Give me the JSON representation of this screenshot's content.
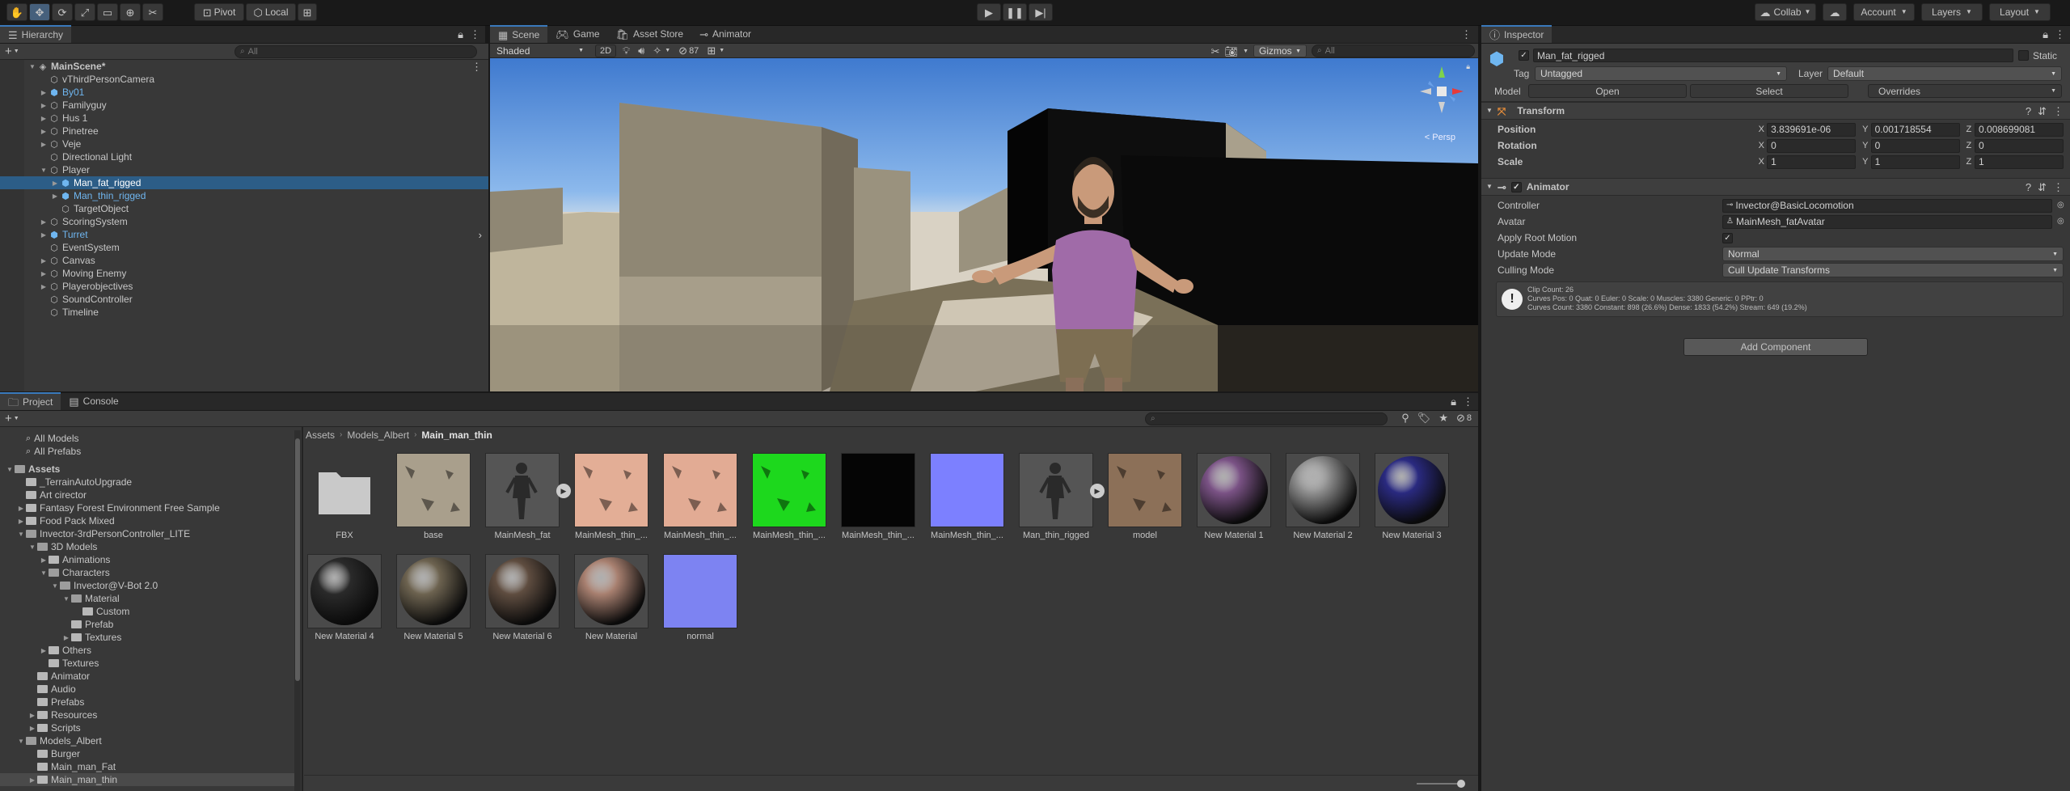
{
  "toolbar": {
    "pivot": "Pivot",
    "local": "Local",
    "collab": "Collab",
    "account": "Account",
    "layers": "Layers",
    "layout": "Layout"
  },
  "hierarchy": {
    "tab": "Hierarchy",
    "search_placeholder": "All",
    "items": [
      {
        "label": "MainScene*",
        "depth": 0,
        "expand": "open",
        "icon": "scene-icon",
        "bold": true
      },
      {
        "label": "vThirdPersonCamera",
        "depth": 1,
        "expand": "",
        "icon": "gameobject-icon"
      },
      {
        "label": "By01",
        "depth": 1,
        "expand": "closed",
        "icon": "prefab-icon",
        "prefab": true
      },
      {
        "label": "Familyguy",
        "depth": 1,
        "expand": "closed",
        "icon": "gameobject-icon"
      },
      {
        "label": "Hus 1",
        "depth": 1,
        "expand": "closed",
        "icon": "gameobject-icon"
      },
      {
        "label": "Pinetree",
        "depth": 1,
        "expand": "closed",
        "icon": "gameobject-icon"
      },
      {
        "label": "Veje",
        "depth": 1,
        "expand": "closed",
        "icon": "gameobject-icon"
      },
      {
        "label": "Directional Light",
        "depth": 1,
        "expand": "",
        "icon": "gameobject-icon"
      },
      {
        "label": "Player",
        "depth": 1,
        "expand": "open",
        "icon": "gameobject-icon"
      },
      {
        "label": "Man_fat_rigged",
        "depth": 2,
        "expand": "closed",
        "icon": "prefab-icon",
        "selected": true
      },
      {
        "label": "Man_thin_rigged",
        "depth": 2,
        "expand": "closed",
        "icon": "prefab-icon",
        "prefab": true
      },
      {
        "label": "TargetObject",
        "depth": 2,
        "expand": "",
        "icon": "gameobject-icon"
      },
      {
        "label": "ScoringSystem",
        "depth": 1,
        "expand": "closed",
        "icon": "gameobject-icon"
      },
      {
        "label": "Turret",
        "depth": 1,
        "expand": "closed",
        "icon": "prefab-icon",
        "prefab": true
      },
      {
        "label": "EventSystem",
        "depth": 1,
        "expand": "",
        "icon": "gameobject-icon"
      },
      {
        "label": "Canvas",
        "depth": 1,
        "expand": "closed",
        "icon": "gameobject-icon"
      },
      {
        "label": "Moving Enemy",
        "depth": 1,
        "expand": "closed",
        "icon": "gameobject-icon"
      },
      {
        "label": "Playerobjectives",
        "depth": 1,
        "expand": "closed",
        "icon": "gameobject-icon"
      },
      {
        "label": "SoundController",
        "depth": 1,
        "expand": "",
        "icon": "gameobject-icon"
      },
      {
        "label": "Timeline",
        "depth": 1,
        "expand": "",
        "icon": "gameobject-icon"
      }
    ]
  },
  "scene": {
    "tabs": [
      "Scene",
      "Game",
      "Asset Store",
      "Animator"
    ],
    "shading": "Shaded",
    "mode_2d": "2D",
    "hidden_count": "87",
    "gizmos": "Gizmos",
    "search_placeholder": "All",
    "persp": "< Persp"
  },
  "project": {
    "tabs": [
      "Project",
      "Console"
    ],
    "hidden_count": "8",
    "breadcrumb": [
      "Assets",
      "Models_Albert",
      "Main_man_thin"
    ],
    "favorites": [
      "All Models",
      "All Prefabs"
    ],
    "tree": [
      {
        "label": "Assets",
        "depth": 0,
        "expand": "open",
        "bold": true
      },
      {
        "label": "_TerrainAutoUpgrade",
        "depth": 1,
        "expand": ""
      },
      {
        "label": "Art cirector",
        "depth": 1,
        "expand": ""
      },
      {
        "label": "Fantasy Forest Environment Free Sample",
        "depth": 1,
        "expand": "closed"
      },
      {
        "label": "Food Pack Mixed",
        "depth": 1,
        "expand": "closed"
      },
      {
        "label": "Invector-3rdPersonController_LITE",
        "depth": 1,
        "expand": "open"
      },
      {
        "label": "3D Models",
        "depth": 2,
        "expand": "open"
      },
      {
        "label": "Animations",
        "depth": 3,
        "expand": "closed"
      },
      {
        "label": "Characters",
        "depth": 3,
        "expand": "open"
      },
      {
        "label": "Invector@V-Bot 2.0",
        "depth": 4,
        "expand": "open"
      },
      {
        "label": "Material",
        "depth": 5,
        "expand": "open"
      },
      {
        "label": "Custom",
        "depth": 6,
        "expand": ""
      },
      {
        "label": "Prefab",
        "depth": 5,
        "expand": ""
      },
      {
        "label": "Textures",
        "depth": 5,
        "expand": "closed"
      },
      {
        "label": "Others",
        "depth": 3,
        "expand": "closed"
      },
      {
        "label": "Textures",
        "depth": 3,
        "expand": ""
      },
      {
        "label": "Animator",
        "depth": 2,
        "expand": ""
      },
      {
        "label": "Audio",
        "depth": 2,
        "expand": ""
      },
      {
        "label": "Prefabs",
        "depth": 2,
        "expand": ""
      },
      {
        "label": "Resources",
        "depth": 2,
        "expand": "closed"
      },
      {
        "label": "Scripts",
        "depth": 2,
        "expand": "closed"
      },
      {
        "label": "Models_Albert",
        "depth": 1,
        "expand": "open"
      },
      {
        "label": "Burger",
        "depth": 2,
        "expand": ""
      },
      {
        "label": "Main_man_Fat",
        "depth": 2,
        "expand": ""
      },
      {
        "label": "Main_man_thin",
        "depth": 2,
        "expand": "closed",
        "selected": true
      }
    ],
    "assets": [
      {
        "label": "FBX",
        "kind": "folder"
      },
      {
        "label": "base",
        "kind": "texture",
        "color": "#a99f8c"
      },
      {
        "label": "MainMesh_fat",
        "kind": "model",
        "play": true
      },
      {
        "label": "MainMesh_thin_...",
        "kind": "texture",
        "color": "#e3ae96"
      },
      {
        "label": "MainMesh_thin_...",
        "kind": "texture",
        "color": "#e2ab94"
      },
      {
        "label": "MainMesh_thin_...",
        "kind": "texture",
        "color": "#1dd81d"
      },
      {
        "label": "MainMesh_thin_...",
        "kind": "solid",
        "color": "#050505"
      },
      {
        "label": "MainMesh_thin_...",
        "kind": "solid",
        "color": "#7c80ff"
      },
      {
        "label": "Man_thin_rigged",
        "kind": "model",
        "play": true
      },
      {
        "label": "model",
        "kind": "texture",
        "color": "#8c7058"
      },
      {
        "label": "New Material 1",
        "kind": "sphere",
        "color": "#7a5285"
      },
      {
        "label": "New Material 2",
        "kind": "sphere",
        "color": "#8e8e8e"
      },
      {
        "label": "New Material 3",
        "kind": "sphere",
        "color": "#2a2a80"
      },
      {
        "label": "New Material 4",
        "kind": "sphere",
        "color": "#2a2a2a"
      },
      {
        "label": "New Material 5",
        "kind": "sphere",
        "color": "#6d6350"
      },
      {
        "label": "New Material 6",
        "kind": "sphere",
        "color": "#5f4d40"
      },
      {
        "label": "New Material",
        "kind": "sphere",
        "color": "#a88070"
      },
      {
        "label": "normal",
        "kind": "solid",
        "color": "#7d83f2"
      }
    ]
  },
  "inspector": {
    "tab": "Inspector",
    "object_name": "Man_fat_rigged",
    "static_label": "Static",
    "tag_label": "Tag",
    "tag_value": "Untagged",
    "layer_label": "Layer",
    "layer_value": "Default",
    "model_label": "Model",
    "open_btn": "Open",
    "select_btn": "Select",
    "overrides_btn": "Overrides",
    "transform": {
      "title": "Transform",
      "rows": [
        {
          "label": "Position",
          "x": "3.839691e-06",
          "y": "0.001718554",
          "z": "0.008699081"
        },
        {
          "label": "Rotation",
          "x": "0",
          "y": "0",
          "z": "0"
        },
        {
          "label": "Scale",
          "x": "1",
          "y": "1",
          "z": "1"
        }
      ],
      "axis_x": "X",
      "axis_y": "Y",
      "axis_z": "Z"
    },
    "animator": {
      "title": "Animator",
      "controller_label": "Controller",
      "controller_value": "Invector@BasicLocomotion",
      "avatar_label": "Avatar",
      "avatar_value": "MainMesh_fatAvatar",
      "root_motion_label": "Apply Root Motion",
      "update_mode_label": "Update Mode",
      "update_mode_value": "Normal",
      "culling_label": "Culling Mode",
      "culling_value": "Cull Update Transforms",
      "info_line1": "Clip Count: 26",
      "info_line2": "Curves Pos: 0 Quat: 0 Euler: 0 Scale: 0 Muscles: 3380 Generic: 0 PPtr: 0",
      "info_line3": "Curves Count: 3380 Constant: 898 (26.6%) Dense: 1833 (54.2%) Stream: 649 (19.2%)"
    },
    "add_component": "Add Component"
  }
}
